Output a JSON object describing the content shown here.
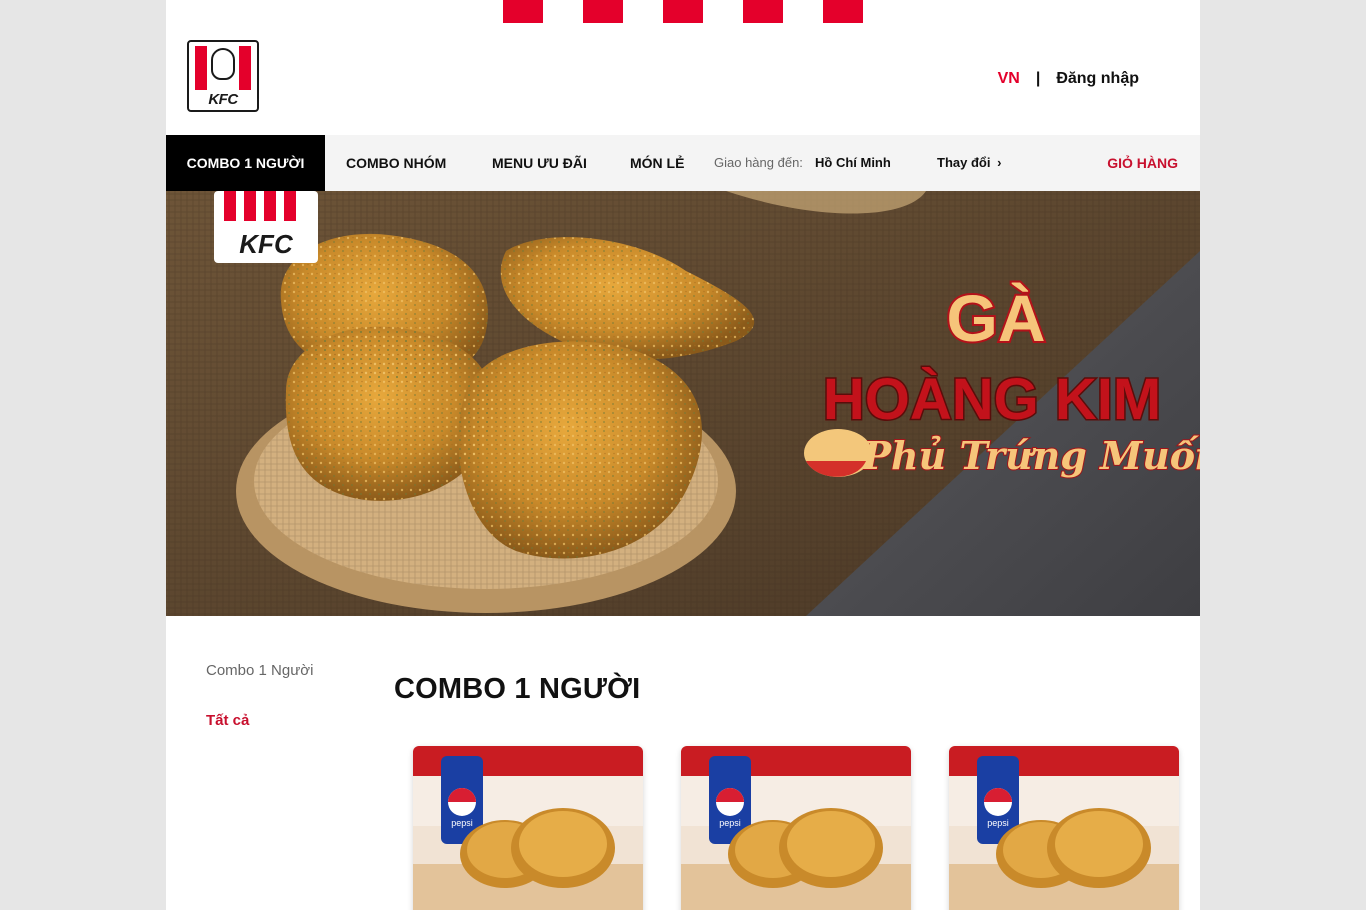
{
  "header": {
    "brand": "KFC",
    "lang": "VN",
    "separator": "|",
    "login": "Đăng nhập"
  },
  "nav": {
    "items": [
      {
        "label": "COMBO 1 NGƯỜI",
        "active": true
      },
      {
        "label": "COMBO NHÓM"
      },
      {
        "label": "MENU ƯU ĐÃI"
      },
      {
        "label": "MÓN LẺ"
      }
    ],
    "delivery_label": "Giao hàng đến:",
    "delivery_city": "Hồ Chí Minh",
    "change_label": "Thay đổi",
    "cart_label": "GIỎ HÀNG"
  },
  "banner": {
    "logo_text": "KFC",
    "headline_1": "GÀ",
    "headline_2": "HOÀNG KIM",
    "tagline": "Phủ Trứng Muối"
  },
  "sidebar": {
    "category": "Combo 1 Người",
    "filter_all": "Tất cả"
  },
  "main": {
    "section_title": "COMBO 1 NGƯỜI",
    "cards": [
      {
        "can_label": "pepsi"
      },
      {
        "can_label": "pepsi"
      },
      {
        "can_label": "pepsi"
      }
    ]
  },
  "colors": {
    "brand_red": "#e4002b",
    "dark_red": "#c8102e",
    "nav_active_bg": "#000000"
  }
}
